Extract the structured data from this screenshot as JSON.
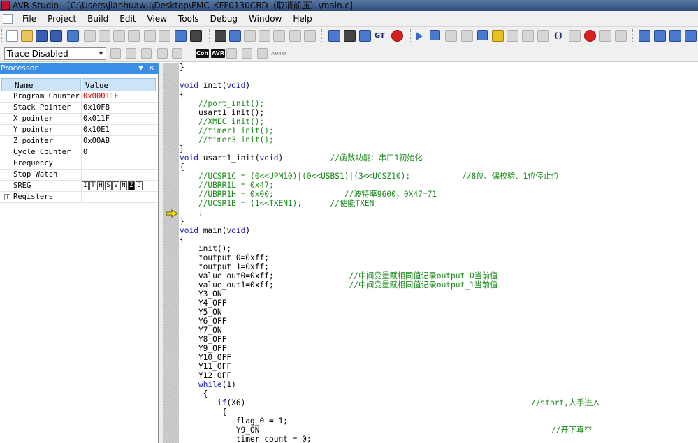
{
  "window": {
    "title": "AVR Studio - [C:\\Users\\jianhuawu\\Desktop\\FMC_KFF0130CBD（取消前压）\\main.c]"
  },
  "menubar": {
    "items": [
      "File",
      "Project",
      "Build",
      "Edit",
      "View",
      "Tools",
      "Debug",
      "Window",
      "Help"
    ]
  },
  "toolbar2": {
    "trace_select_value": "Trace Disabled",
    "badge_con": "Con",
    "badge_avr": "AVR",
    "auto_label": "AUTO"
  },
  "processor": {
    "title": "Processor",
    "columns": {
      "name": "Name",
      "value": "Value"
    },
    "rows": [
      {
        "name": "Program Counter",
        "value": "0x00011F"
      },
      {
        "name": "Stack Pointer",
        "value": "0x10FB"
      },
      {
        "name": "X pointer",
        "value": "0x011F"
      },
      {
        "name": "Y pointer",
        "value": "0x10E1"
      },
      {
        "name": "Z pointer",
        "value": "0x00AB"
      },
      {
        "name": "Cycle Counter",
        "value": "0"
      },
      {
        "name": "Frequency",
        "value": ""
      },
      {
        "name": "Stop Watch",
        "value": ""
      }
    ],
    "sreg": {
      "name": "SREG",
      "bits": [
        "I",
        "T",
        "H",
        "S",
        "V",
        "N",
        "Z",
        "C"
      ]
    },
    "registers_label": "Registers",
    "colors": {
      "header": "#3a8ee6",
      "changed_value": "#d40000"
    }
  },
  "editor": {
    "lines": [
      {
        "code": "}",
        "comment": ""
      },
      {
        "code": "",
        "comment": ""
      },
      {
        "code": "void init(void)",
        "comment": ""
      },
      {
        "code": "{",
        "comment": ""
      },
      {
        "code": "    ",
        "comment": "//port_init();"
      },
      {
        "code": "    usart1_init();",
        "comment": ""
      },
      {
        "code": "    ",
        "comment": "//XMEC_init();"
      },
      {
        "code": "    ",
        "comment": "//timer1_init();"
      },
      {
        "code": "    ",
        "comment": "//timer3_init();"
      },
      {
        "code": "}",
        "comment": ""
      },
      {
        "code": "void usart1_init(void)          ",
        "comment": "//函数功能：串口1初始化"
      },
      {
        "code": "{",
        "comment": ""
      },
      {
        "code": "    ",
        "comment": "//UCSR1C = (0<<UPM10)|(0<<USBS1)|(3<<UCSZ10);           //8位、偶校验、1位停止位"
      },
      {
        "code": "    ",
        "comment": "//UBRR1L = 0x47;"
      },
      {
        "code": "    ",
        "comment": "//UBRR1H = 0x00;               //波特率9600，0X47=71"
      },
      {
        "code": "    ",
        "comment": "//UCSR1B = (1<<TXEN1);      //使能TXEN"
      },
      {
        "code": "    ",
        "comment": ";"
      },
      {
        "code": "}",
        "comment": ""
      },
      {
        "code": "void main(void)",
        "comment": ""
      },
      {
        "code": "{",
        "comment": ""
      },
      {
        "code": "    init();",
        "comment": ""
      },
      {
        "code": "    *output_0=0xff;",
        "comment": ""
      },
      {
        "code": "    *output_1=0xff;",
        "comment": ""
      },
      {
        "code": "    value_out0=0xff;                ",
        "comment": "//中间变量赋相同值记录output_0当前值"
      },
      {
        "code": "    value_out1=0xff;                ",
        "comment": "//中间变量赋相同值记录output_1当前值"
      },
      {
        "code": "    Y3_ON",
        "comment": ""
      },
      {
        "code": "    Y4_OFF",
        "comment": ""
      },
      {
        "code": "    Y5_ON",
        "comment": ""
      },
      {
        "code": "    Y6_OFF",
        "comment": ""
      },
      {
        "code": "    Y7_ON",
        "comment": ""
      },
      {
        "code": "    Y8_OFF",
        "comment": ""
      },
      {
        "code": "    Y9_OFF",
        "comment": ""
      },
      {
        "code": "    Y10_OFF",
        "comment": ""
      },
      {
        "code": "    Y11_OFF",
        "comment": ""
      },
      {
        "code": "    Y12_OFF",
        "comment": ""
      },
      {
        "code": "    while(1)",
        "comment": ""
      },
      {
        "code": "     {",
        "comment": ""
      },
      {
        "code": "        if(X6)",
        "comment": "//start,人手进入"
      },
      {
        "code": "         {",
        "comment": ""
      },
      {
        "code": "            flag_0 = 1;",
        "comment": ""
      },
      {
        "code": "            Y9_ON",
        "comment": "//开下真空"
      },
      {
        "code": "            timer_count = 0;",
        "comment": ""
      }
    ],
    "colors": {
      "comment": "#1a8a1a",
      "keyword": "#1a1ab8"
    },
    "current_line_marker": "yellow-arrow"
  }
}
